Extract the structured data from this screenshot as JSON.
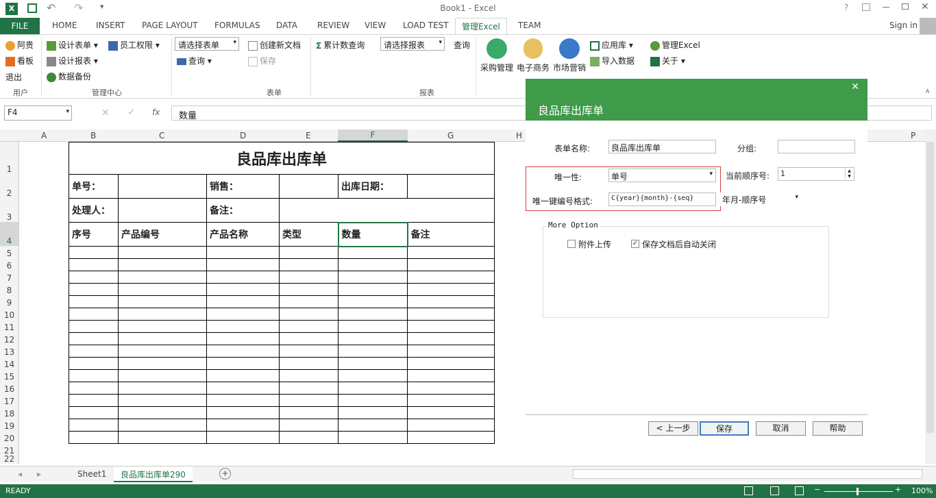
{
  "window": {
    "title": "Book1 - Excel",
    "help": "?",
    "sign_in": "Sign in"
  },
  "tabs": [
    "FILE",
    "HOME",
    "INSERT",
    "PAGE LAYOUT",
    "FORMULAS",
    "DATA",
    "REVIEW",
    "VIEW",
    "LOAD TEST",
    "管理Excel",
    "TEAM"
  ],
  "ribbon": {
    "user": {
      "items": [
        "阿贵",
        "看板",
        "退出"
      ],
      "group": "用户"
    },
    "mgmt": {
      "items": [
        "设计表单",
        "设计报表",
        "数据备份",
        "员工权限"
      ],
      "group": "管理中心"
    },
    "form": {
      "select": "请选择表单",
      "query": "查询",
      "new_doc": "创建新文档",
      "save": "保存",
      "group": "表单"
    },
    "report": {
      "cum_query": "累计数查询",
      "select": "请选择报表",
      "query": "查询",
      "group": "报表"
    },
    "apps": [
      "采购管理",
      "电子商务",
      "市场营销"
    ],
    "extra": {
      "app_store": "应用库",
      "import": "导入数据",
      "manage": "管理Excel",
      "about": "关于"
    }
  },
  "formula": {
    "name_box": "F4",
    "fx": "fx",
    "value": "数量"
  },
  "columns": [
    "A",
    "B",
    "C",
    "D",
    "E",
    "F",
    "G",
    "H",
    "P"
  ],
  "rows": [
    "1",
    "2",
    "3",
    "4",
    "5",
    "6",
    "7",
    "8",
    "9",
    "10",
    "11",
    "12",
    "13",
    "14",
    "15",
    "16",
    "17",
    "18",
    "19",
    "20",
    "21",
    "22"
  ],
  "sheet": {
    "title": "良品库出库单",
    "r2": [
      "单号：",
      "销售：",
      "出库日期："
    ],
    "r3": [
      "处理人：",
      "备注："
    ],
    "headers": [
      "序号",
      "产品编号",
      "产品名称",
      "类型",
      "数量",
      "备注"
    ]
  },
  "dialog": {
    "title": "良品库出库单",
    "form_name_label": "表单名称:",
    "form_name_value": "良品库出库单",
    "group_label": "分组:",
    "group_value": "",
    "unique_label": "唯一性:",
    "unique_value": "单号",
    "seq_label": "当前顺序号:",
    "seq_value": "1",
    "format_label": "唯一键编号格式:",
    "format_value": "C{year}{month}-{seq}",
    "format_select": "年月-顺序号",
    "more_option": "More Option",
    "attach_label": "附件上传",
    "autoclose_label": "保存文档后自动关闭",
    "buttons": {
      "prev": "上一步",
      "save": "保存",
      "cancel": "取消",
      "help": "帮助"
    }
  },
  "sheet_tabs": [
    "Sheet1",
    "良品库出库单290"
  ],
  "status": {
    "ready": "READY",
    "zoom": "100%"
  },
  "colors": {
    "excel_green": "#217346",
    "dialog_green": "#3f9a4a"
  }
}
